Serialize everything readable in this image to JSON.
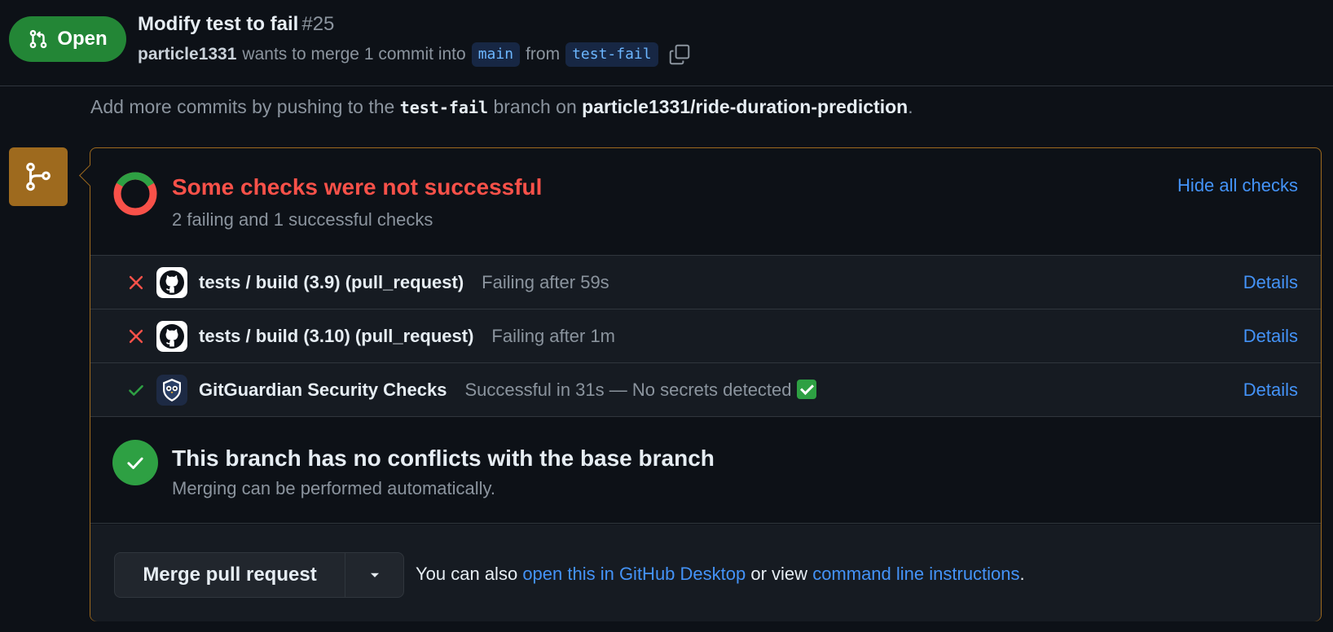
{
  "header": {
    "state_label": "Open",
    "title": "Modify test to fail",
    "number": "#25",
    "author": "particle1331",
    "merge_text": "wants to merge 1 commit into",
    "base_branch": "main",
    "from_text": "from",
    "head_branch": "test-fail"
  },
  "hint": {
    "prefix": "Add more commits by pushing to the",
    "branch": "test-fail",
    "middle": "branch on",
    "repo": "particle1331/ride-duration-prediction",
    "suffix": "."
  },
  "checks": {
    "summary_title": "Some checks were not successful",
    "summary_sub": "2 failing and 1 successful checks",
    "toggle_label": "Hide all checks",
    "items": [
      {
        "status": "fail",
        "avatar": "github-icon",
        "name": "tests / build (3.9) (pull_request)",
        "description": "Failing after 59s",
        "details_label": "Details"
      },
      {
        "status": "fail",
        "avatar": "github-icon",
        "name": "tests / build (3.10) (pull_request)",
        "description": "Failing after 1m",
        "details_label": "Details"
      },
      {
        "status": "success",
        "avatar": "gitguardian-owl-icon",
        "name": "GitGuardian Security Checks",
        "description": "Successful in 31s — No secrets detected",
        "details_label": "Details"
      }
    ]
  },
  "conflicts": {
    "title": "This branch has no conflicts with the base branch",
    "subtitle": "Merging can be performed automatically."
  },
  "merge": {
    "button_label": "Merge pull request",
    "hint_prefix": "You can also",
    "desktop_link": "open this in GitHub Desktop",
    "hint_middle": "or view",
    "cli_link": "command line instructions",
    "hint_suffix": "."
  },
  "colors": {
    "open_green": "#238636",
    "fail_red": "#f85149",
    "success_green": "#2ea043",
    "link_blue": "#4493f8",
    "merge_border": "#9e6a1e"
  }
}
